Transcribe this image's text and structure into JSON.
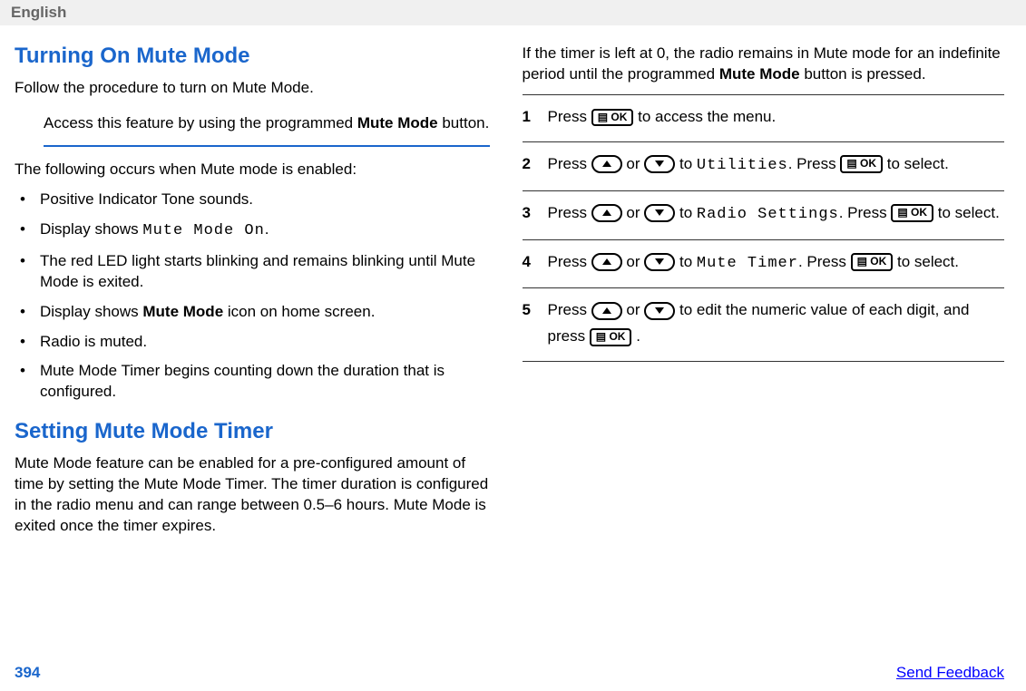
{
  "header": {
    "language": "English"
  },
  "left": {
    "title1": "Turning On Mute Mode",
    "intro1": "Follow the procedure to turn on Mute Mode.",
    "indent1_a": "Access this feature by using the programmed ",
    "indent1_b": "Mute Mode",
    "indent1_c": " button.",
    "follow_text": "The following occurs when Mute mode is enabled:",
    "bullets": [
      {
        "text": "Positive Indicator Tone sounds."
      },
      {
        "text_a": "Display shows ",
        "code": "Mute Mode On",
        "text_b": "."
      },
      {
        "text": "The red LED light starts blinking and remains blinking until Mute Mode is exited."
      },
      {
        "text_a": "Display shows ",
        "bold": "Mute Mode",
        "text_b": " icon on home screen."
      },
      {
        "text": "Radio is muted."
      },
      {
        "text": "Mute Mode Timer begins counting down the duration that is configured."
      }
    ],
    "title2": "Setting Mute Mode Timer",
    "intro2": "Mute Mode feature can be enabled for a pre-configured amount of time by setting the Mute Mode Timer. The timer duration is configured in the radio menu and can range between 0.5–6 hours. Mute Mode is exited once the timer expires."
  },
  "right": {
    "top_a": "If the timer is left at 0, the radio remains in Mute mode for an indefinite period until the programmed ",
    "top_b": "Mute Mode",
    "top_c": " button is pressed.",
    "steps": [
      {
        "n": "1",
        "a": "Press ",
        "icon1": "ok",
        "b": " to access the menu."
      },
      {
        "n": "2",
        "a": "Press ",
        "icon1": "up",
        "b": " or ",
        "icon2": "down",
        "c": " to ",
        "code": "Utilities",
        "d": ". Press ",
        "icon3": "ok",
        "e": " to select."
      },
      {
        "n": "3",
        "a": "Press ",
        "icon1": "up",
        "b": " or ",
        "icon2": "down",
        "c": " to ",
        "code": "Radio Settings",
        "d": ". Press ",
        "icon3": "ok",
        "e": " to select."
      },
      {
        "n": "4",
        "a": "Press ",
        "icon1": "up",
        "b": " or ",
        "icon2": "down",
        "c": " to ",
        "code": "Mute Timer",
        "d": ". Press ",
        "icon3": "ok",
        "e": " to select."
      },
      {
        "n": "5",
        "a": "Press ",
        "icon1": "up",
        "b": " or ",
        "icon2": "down",
        "c": " to edit the numeric value of each digit, and press ",
        "icon3": "ok",
        "d": " ."
      }
    ]
  },
  "footer": {
    "page": "394",
    "feedback": "Send Feedback"
  }
}
